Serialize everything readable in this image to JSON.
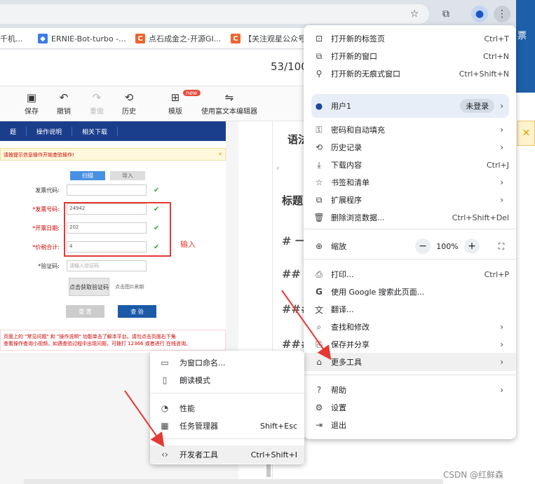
{
  "toolbar": {
    "star_icon": "star-icon",
    "ext_icon": "puzzle-icon",
    "profile_icon": "profile-icon",
    "menu_icon": "kebab-icon"
  },
  "bookmarks": [
    {
      "label": "千机..."
    },
    {
      "label": "ERNIE-Bot-turbo -..."
    },
    {
      "label": "点石成金之-开源GI..."
    },
    {
      "label": "【关注观星公众号..."
    }
  ],
  "side_banner": "票",
  "document": {
    "page_number": "53/100",
    "edit_buttons": [
      {
        "label": "保存",
        "icon": "save-icon"
      },
      {
        "label": "撤销",
        "icon": "undo-icon"
      },
      {
        "label": "重做",
        "icon": "redo-icon"
      },
      {
        "label": "历史",
        "icon": "history-icon"
      },
      {
        "label": "模版",
        "icon": "template-icon"
      },
      {
        "label": "使用富文本编辑器",
        "icon": "swap-icon"
      }
    ],
    "new_badge": "new"
  },
  "invoice_form": {
    "tabs": [
      "题",
      "操作说明",
      "相关下载"
    ],
    "notice": "请按提示信息操作开始查验操作!",
    "scan_tab": "扫描",
    "import_tab": "导入",
    "fields": [
      {
        "label": "发票代码:",
        "value": "",
        "required": false
      },
      {
        "label": "*发票号码:",
        "value": "24942",
        "required": true
      },
      {
        "label": "*开票日期:",
        "value": "202",
        "required": true
      },
      {
        "label": "*价税合计:",
        "value": "4",
        "required": true
      },
      {
        "label": "*验证码:",
        "value": "请输入验证码",
        "required": false
      }
    ],
    "captcha_button": "点击获取验证码",
    "captcha_hint": "点击图片刷新",
    "reset_button": "重 置",
    "verify_button": "查 验",
    "input_note": "输入",
    "warning_line1": "页面上的 \"常见问题\" 和 \"操作说明\" 功能单击了解本平台。请勿点击页面右下角",
    "warning_line2": "查看操作查询小视频。如遇查验过程中出现问题，可拨打 12366 或者进行 在线咨询。"
  },
  "markdown_preview": {
    "heading": "语法",
    "title": "标题",
    "lines": [
      "# 一",
      "## ",
      "###",
      "###"
    ]
  },
  "chrome_menu": {
    "items_top": [
      {
        "label": "打开新的标签页",
        "shortcut": "Ctrl+T",
        "icon": "new-tab-icon"
      },
      {
        "label": "打开新的窗口",
        "shortcut": "Ctrl+N",
        "icon": "new-window-icon"
      },
      {
        "label": "打开新的无痕式窗口",
        "shortcut": "Ctrl+Shift+N",
        "icon": "incognito-icon"
      }
    ],
    "profile": {
      "name": "用户1",
      "status": "未登录"
    },
    "items_mid": [
      {
        "label": "密码和自动填充",
        "shortcut": "",
        "icon": "key-icon",
        "submenu": true
      },
      {
        "label": "历史记录",
        "shortcut": "",
        "icon": "history-icon",
        "submenu": true
      },
      {
        "label": "下载内容",
        "shortcut": "Ctrl+J",
        "icon": "download-icon",
        "submenu": false
      },
      {
        "label": "书签和清单",
        "shortcut": "",
        "icon": "star-icon",
        "submenu": true
      },
      {
        "label": "扩展程序",
        "shortcut": "",
        "icon": "puzzle-icon",
        "submenu": true
      },
      {
        "label": "删除浏览数据...",
        "shortcut": "Ctrl+Shift+Del",
        "icon": "trash-icon",
        "submenu": false
      }
    ],
    "zoom": {
      "label": "缩放",
      "value": "100%",
      "minus": "−",
      "plus": "+"
    },
    "items_tools": [
      {
        "label": "打印...",
        "shortcut": "Ctrl+P",
        "icon": "print-icon",
        "submenu": false
      },
      {
        "label": "使用 Google 搜索此页面...",
        "shortcut": "",
        "icon": "google-icon",
        "submenu": false
      },
      {
        "label": "翻译...",
        "shortcut": "",
        "icon": "translate-icon",
        "submenu": false
      },
      {
        "label": "查找和修改",
        "shortcut": "",
        "icon": "find-icon",
        "submenu": true
      },
      {
        "label": "保存并分享",
        "shortcut": "",
        "icon": "save-share-icon",
        "submenu": true
      },
      {
        "label": "更多工具",
        "shortcut": "",
        "icon": "toolbox-icon",
        "submenu": true
      }
    ],
    "items_bottom": [
      {
        "label": "帮助",
        "shortcut": "",
        "icon": "help-icon",
        "submenu": true
      },
      {
        "label": "设置",
        "shortcut": "",
        "icon": "settings-icon",
        "submenu": false
      },
      {
        "label": "退出",
        "shortcut": "",
        "icon": "exit-icon",
        "submenu": false
      }
    ]
  },
  "more_tools_submenu": [
    {
      "label": "为窗口命名...",
      "shortcut": "",
      "icon": "window-name-icon"
    },
    {
      "label": "朗读模式",
      "shortcut": "",
      "icon": "reading-mode-icon"
    },
    {
      "label": "性能",
      "shortcut": "",
      "icon": "performance-icon"
    },
    {
      "label": "任务管理器",
      "shortcut": "Shift+Esc",
      "icon": "task-manager-icon"
    },
    {
      "label": "开发者工具",
      "shortcut": "Ctrl+Shift+I",
      "icon": "devtools-icon"
    }
  ],
  "watermark": "CSDN @红鲜森",
  "colors": {
    "annotation": "#e53935",
    "form_header": "#1b3e8c",
    "menu_bg": "#ffffff"
  }
}
